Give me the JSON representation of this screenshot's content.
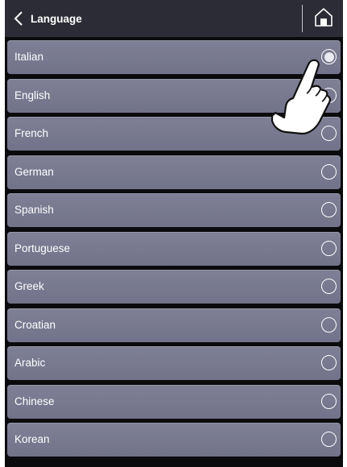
{
  "header": {
    "title": "Language",
    "back_icon": "chevron-left-icon",
    "home_icon": "home-icon"
  },
  "languages": [
    {
      "label": "Italian",
      "selected": true
    },
    {
      "label": "English",
      "selected": false
    },
    {
      "label": "French",
      "selected": false
    },
    {
      "label": "German",
      "selected": false
    },
    {
      "label": "Spanish",
      "selected": false
    },
    {
      "label": "Portuguese",
      "selected": false
    },
    {
      "label": "Greek",
      "selected": false
    },
    {
      "label": "Croatian",
      "selected": false
    },
    {
      "label": "Arabic",
      "selected": false
    },
    {
      "label": "Chinese",
      "selected": false
    },
    {
      "label": "Korean",
      "selected": false
    }
  ],
  "overlay": {
    "pointer_icon": "pointing-hand-icon"
  },
  "colors": {
    "background": "#0b0b0e",
    "header": "#2b2c36",
    "row": "#7a7b90",
    "text": "#ffffff"
  }
}
